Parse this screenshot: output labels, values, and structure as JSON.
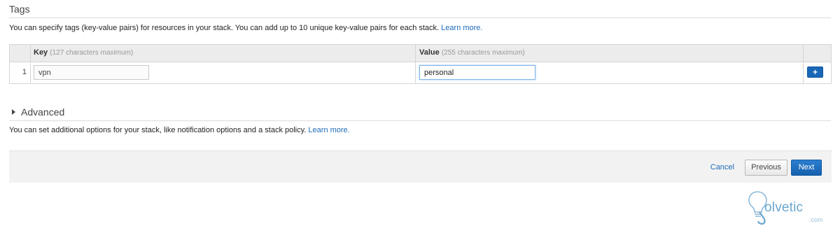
{
  "tags": {
    "title": "Tags",
    "description": "You can specify tags (key-value pairs) for resources in your stack. You can add up to 10 unique key-value pairs for each stack.",
    "learn_more": "Learn more.",
    "table": {
      "key_header": "Key",
      "key_hint": "(127 characters maximum)",
      "value_header": "Value",
      "value_hint": "(255 characters maximum)",
      "rows": [
        {
          "number": "1",
          "key": "vpn",
          "value": "personal"
        }
      ],
      "add_label": "+"
    }
  },
  "advanced": {
    "title": "Advanced",
    "description": "You can set additional options for your stack, like notification options and a stack policy.",
    "learn_more": "Learn more."
  },
  "footer": {
    "cancel": "Cancel",
    "previous": "Previous",
    "next": "Next"
  },
  "watermark": {
    "text": "olvetic",
    "suffix": ".com"
  },
  "colors": {
    "link": "#1e6bb8",
    "primary_button": "#1a67b7",
    "header_bg": "#ececec",
    "footer_bg": "#f2f2f2"
  }
}
